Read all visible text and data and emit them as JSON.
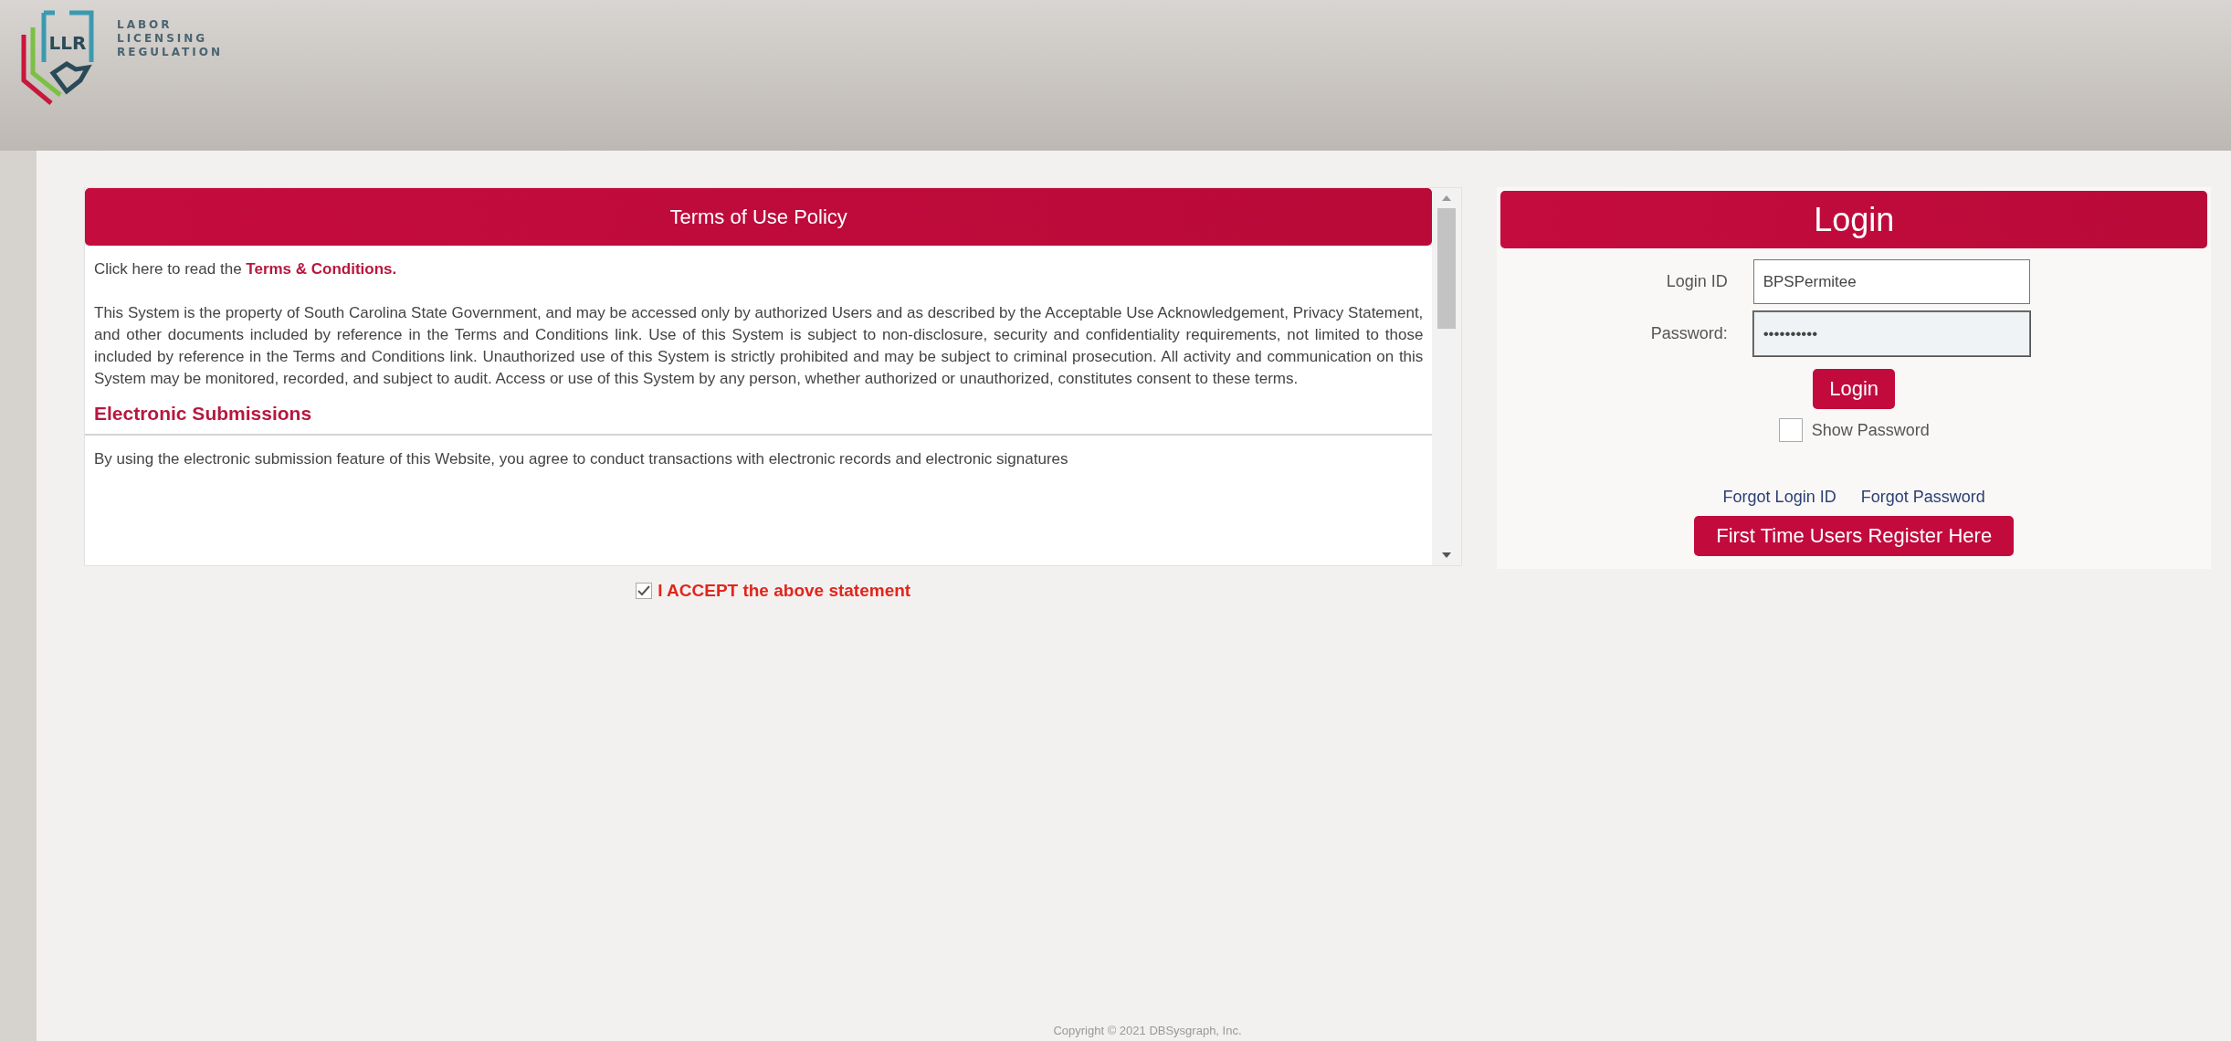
{
  "header": {
    "logo_mark": "LLR",
    "logo_lines": [
      "LABOR",
      "LICENSING",
      "REGULATION"
    ]
  },
  "terms": {
    "title": "Terms of Use Policy",
    "intro": "Click here to read the **Terms & Conditions**.",
    "body": "This System is the property of South Carolina State Government, and may be accessed only by authorized Users and as described by the Acceptable Use Acknowledgement, Privacy Statement, and other documents included by reference in the Terms and Conditions link. Use of this System is subject to non-disclosure, security and confidentiality requirements, not limited to those included by reference in the Terms and Conditions link. Unauthorized use of this System is strictly prohibited and may be subject to criminal prosecution. All activity and communication on this System may be monitored, recorded, and subject to audit. Access or use of this System by any person, whether authorized or unauthorized, constitutes consent to these terms.",
    "section_heading": "Electronic Submissions",
    "section_text": "By using the electronic submission feature of this Website, you agree to conduct transactions with electronic records and electronic signatures"
  },
  "accept": {
    "label": "I ACCEPT the above statement",
    "checked": true
  },
  "login": {
    "title": "Login",
    "fields": [
      {
        "label": "Login ID",
        "value": "BPSPermitee",
        "focused": false
      },
      {
        "label": "Password:",
        "value": "••••••••••",
        "focused": true
      }
    ],
    "button": "Login",
    "show_password": {
      "label": "Show Password",
      "checked": false
    },
    "links": [
      "Forgot Login ID",
      "Forgot Password"
    ],
    "register": "First Time Users Register Here"
  },
  "footer": "Copyright © 2021 DBSysgraph, Inc."
}
